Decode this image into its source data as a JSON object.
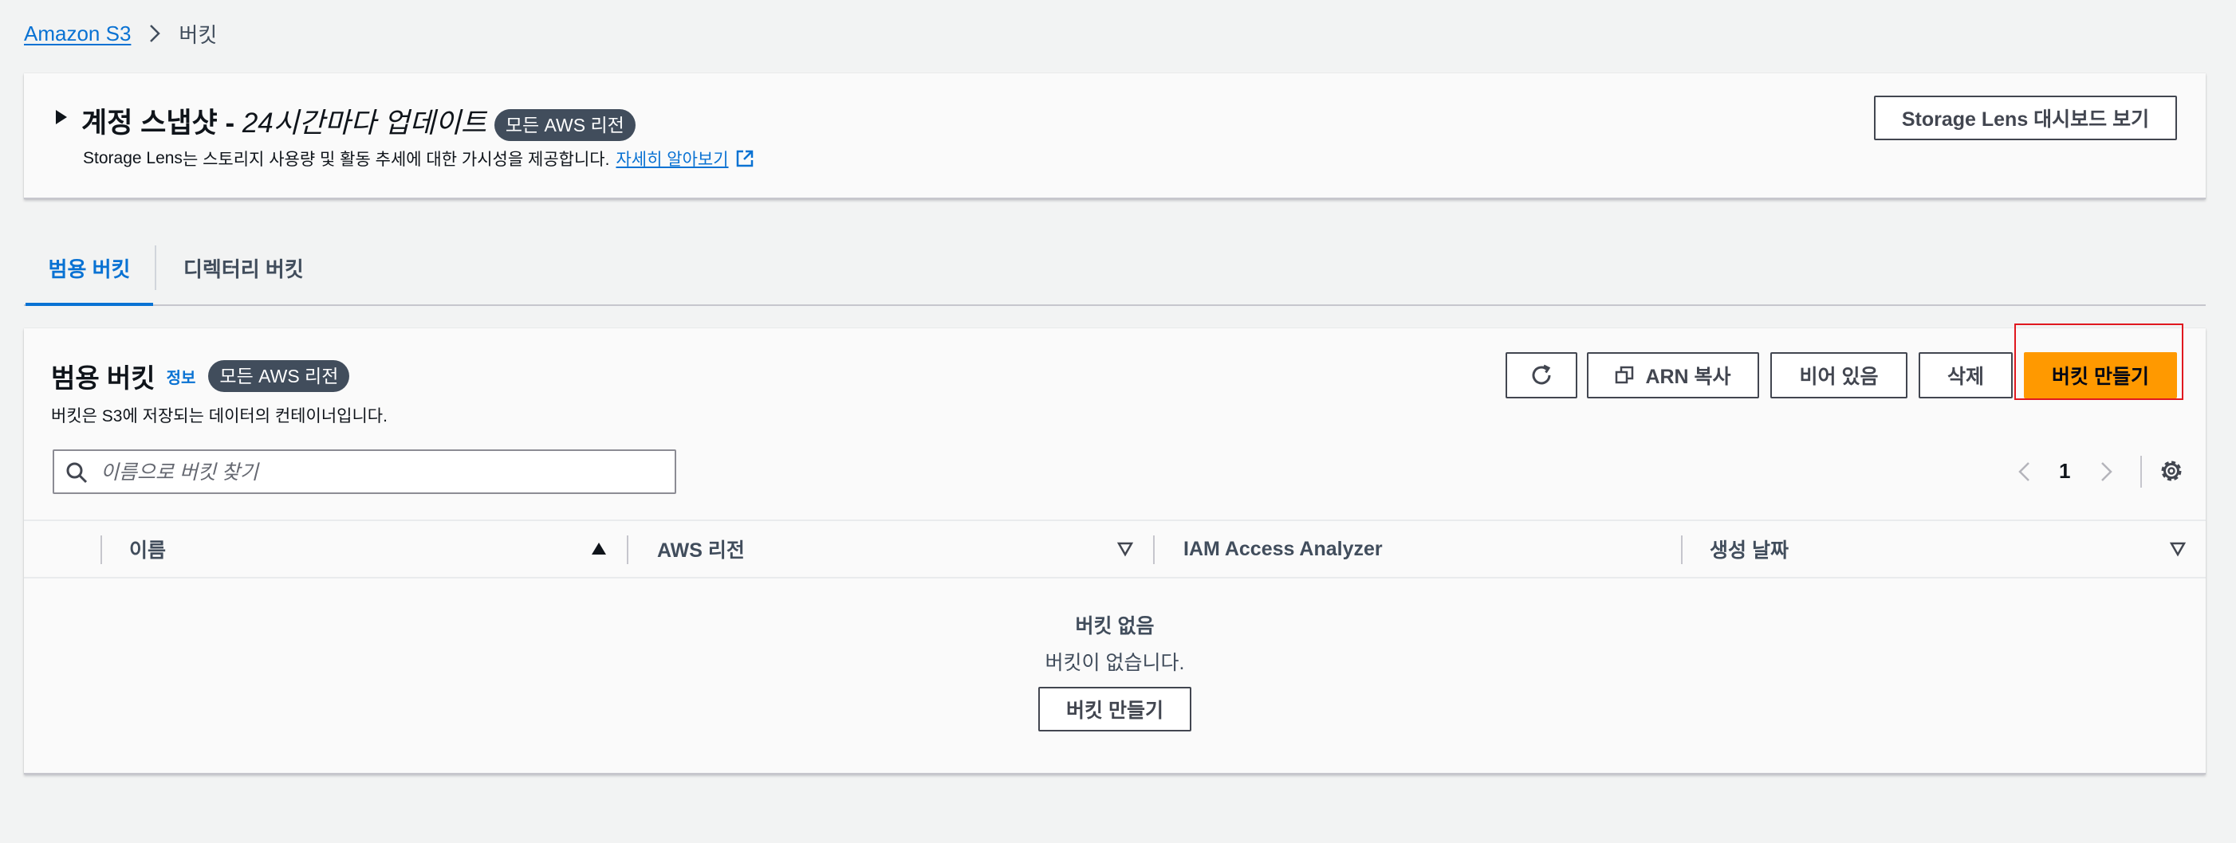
{
  "breadcrumb": {
    "root": "Amazon S3",
    "current": "버킷"
  },
  "snapshot": {
    "title_bold": "계정 스냅샷 -",
    "title_italic": "24시간마다 업데이트",
    "badge": "모든 AWS 리전",
    "description_brand": "Storage Lens",
    "description_rest": "는 스토리지 사용량 및 활동 추세에 대한 가시성을 제공합니다.",
    "learn_more": "자세히 알아보기",
    "dashboard_button": "Storage Lens 대시보드 보기"
  },
  "tabs": [
    {
      "label": "범용 버킷",
      "active": true
    },
    {
      "label": "디렉터리 버킷",
      "active": false
    }
  ],
  "panel": {
    "title": "범용 버킷",
    "info": "정보",
    "badge": "모든 AWS 리전",
    "description": "버킷은 S3에 저장되는 데이터의 컨테이너입니다.",
    "buttons": {
      "copy_arn": "ARN 복사",
      "empty": "비어 있음",
      "delete": "삭제",
      "create": "버킷 만들기"
    },
    "search_placeholder": "이름으로 버킷 찾기",
    "pagination": {
      "current_page": "1"
    }
  },
  "table": {
    "columns": [
      "이름",
      "AWS 리전",
      "IAM Access Analyzer",
      "생성 날짜"
    ]
  },
  "empty_state": {
    "title": "버킷 없음",
    "description": "버킷이 없습니다.",
    "create_button": "버킷 만들기"
  },
  "colors": {
    "link": "#0972d3",
    "primary_button": "#ff9900",
    "badge": "#414d5c",
    "highlight": "#e0181f"
  }
}
